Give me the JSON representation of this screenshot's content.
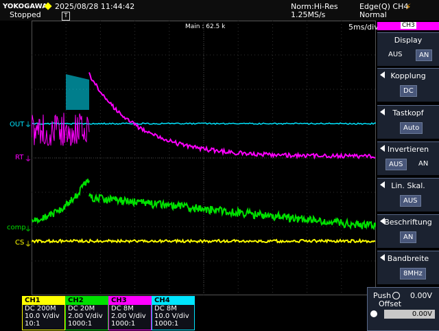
{
  "header": {
    "brand": "YOKOGAWA",
    "datetime": "2025/08/28 11:44:42",
    "status": "Stopped",
    "acq_mode": "Norm:Hi-Res",
    "sample_rate": "1.25MS/s",
    "trigger": "Edge(Q) CH4",
    "trigger_mode": "Normal"
  },
  "screen": {
    "main_label": "Main : 62.5 k",
    "timebase": "5ms/div",
    "active_channel": "CH3",
    "trace_labels": {
      "out": "OUT",
      "rt": "RT",
      "comp": "comp",
      "cs": "CS"
    }
  },
  "menu": [
    {
      "title": "Display",
      "options": [
        "AUS",
        "AN"
      ],
      "selected": "AN"
    },
    {
      "title": "Kopplung",
      "options": [
        "DC"
      ],
      "selected": "DC"
    },
    {
      "title": "Tastkopf",
      "options": [
        "Auto"
      ],
      "selected": "Auto"
    },
    {
      "title": "Invertieren",
      "options": [
        "AUS",
        "AN"
      ],
      "selected": "AUS"
    },
    {
      "title": "Lin. Skal.",
      "options": [
        "AUS"
      ],
      "selected": "AUS"
    },
    {
      "title": "Beschriftung",
      "options": [
        "AN"
      ],
      "selected": "AN"
    },
    {
      "title": "Bandbreite",
      "options": [
        "8MHz"
      ],
      "selected": "8MHz"
    }
  ],
  "offset": {
    "push": "Push",
    "label": "Offset",
    "value": "0.00V",
    "field": "0.00V"
  },
  "channels": [
    {
      "name": "CH1",
      "coupling": "DC 200M",
      "scale": "10.0 V/div",
      "probe": "10:1",
      "color": "#ffff00"
    },
    {
      "name": "CH2",
      "coupling": "DC 20M",
      "scale": "2.00 V/div",
      "probe": "1000:1",
      "color": "#00e000"
    },
    {
      "name": "CH3",
      "coupling": "DC 8M",
      "scale": "2.00 V/div",
      "probe": "1000:1",
      "color": "#ff00ff"
    },
    {
      "name": "CH4",
      "coupling": "DC 8M",
      "scale": "10.0 V/div",
      "probe": "1000:1",
      "color": "#00e5ff"
    }
  ],
  "colors": {
    "ch1": "#ffff00",
    "ch2": "#00e000",
    "ch3": "#ff00ff",
    "ch4": "#00e5ff",
    "trigger": "#ffa500"
  }
}
